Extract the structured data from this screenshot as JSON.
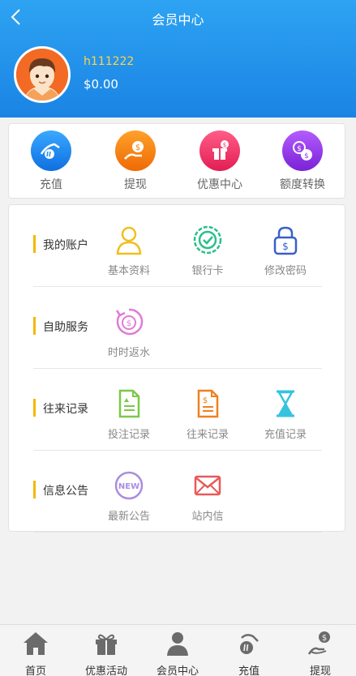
{
  "header": {
    "title": "会员中心",
    "back_icon": "chevron-left-icon"
  },
  "user": {
    "username": "h111222",
    "balance": "$0.00"
  },
  "quick_actions": [
    {
      "label": "充值",
      "icon": "recharge-icon",
      "color": "#1f8ef0"
    },
    {
      "label": "提现",
      "icon": "withdraw-icon",
      "color": "#f57d10"
    },
    {
      "label": "优惠中心",
      "icon": "promotion-icon",
      "color": "#ef3b6b"
    },
    {
      "label": "额度转换",
      "icon": "exchange-icon",
      "color": "#9a3de8"
    }
  ],
  "sections": [
    {
      "title": "我的账户",
      "items": [
        {
          "label": "基本资料",
          "icon": "user-icon"
        },
        {
          "label": "银行卡",
          "icon": "bank-card-icon"
        },
        {
          "label": "修改密码",
          "icon": "lock-icon"
        }
      ]
    },
    {
      "title": "自助服务",
      "items": [
        {
          "label": "时时返水",
          "icon": "rebate-icon"
        }
      ]
    },
    {
      "title": "往来记录",
      "items": [
        {
          "label": "投注记录",
          "icon": "bet-record-icon"
        },
        {
          "label": "往来记录",
          "icon": "transaction-record-icon"
        },
        {
          "label": "充值记录",
          "icon": "hourglass-icon"
        }
      ]
    },
    {
      "title": "信息公告",
      "items": [
        {
          "label": "最新公告",
          "icon": "new-badge-icon"
        },
        {
          "label": "站内信",
          "icon": "mail-icon"
        }
      ]
    }
  ],
  "tabbar": [
    {
      "label": "首页",
      "icon": "home-icon"
    },
    {
      "label": "优惠活动",
      "icon": "gift-icon"
    },
    {
      "label": "会员中心",
      "icon": "person-icon"
    },
    {
      "label": "充值",
      "icon": "recharge-icon"
    },
    {
      "label": "提现",
      "icon": "withdraw-icon"
    }
  ],
  "colors": {
    "header": "#1a84e4",
    "accent_bar": "#f5b800",
    "username": "#ffd24a"
  }
}
